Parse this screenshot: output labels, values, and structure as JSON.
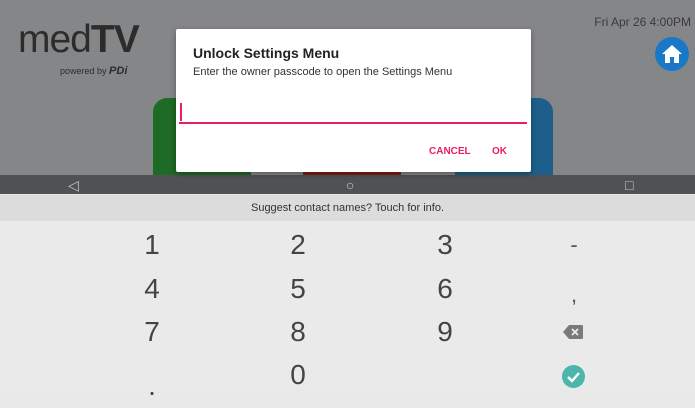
{
  "launcher": {
    "logo_light": "med",
    "logo_bold": "TV",
    "logo_tag": "powered by",
    "logo_brand": "PDi",
    "datetime": "Fri Apr 26  4:00PM"
  },
  "dialog": {
    "title": "Unlock Settings Menu",
    "message": "Enter the owner passcode to open the Settings Menu",
    "input_value": "",
    "cancel_label": "CANCEL",
    "ok_label": "OK"
  },
  "keyboard": {
    "suggestion": "Suggest contact names? Touch for info.",
    "rows": [
      [
        "1",
        "2",
        "3",
        "-"
      ],
      [
        "4",
        "5",
        "6",
        ","
      ],
      [
        "7",
        "8",
        "9"
      ],
      [
        ".",
        "0"
      ]
    ],
    "accent_color": "#4db6ac"
  },
  "colors": {
    "accent": "#e91e63",
    "home_button": "#1a78c9"
  }
}
